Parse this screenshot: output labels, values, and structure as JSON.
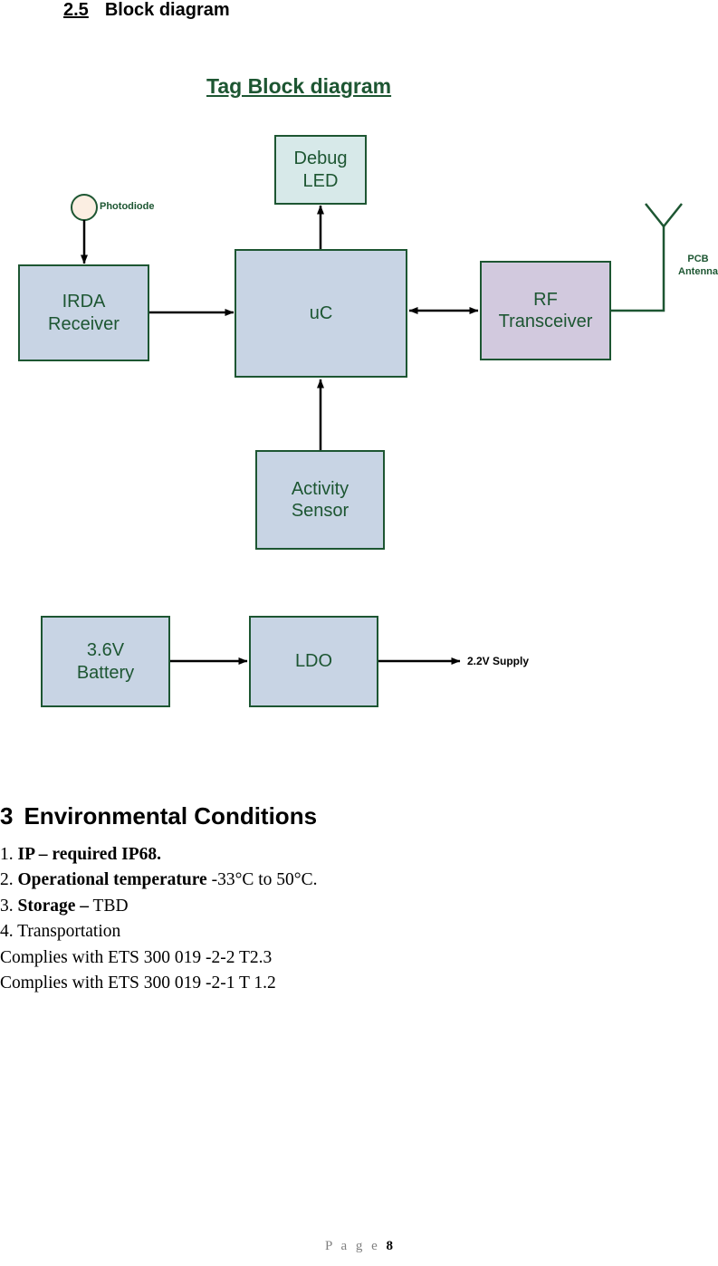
{
  "section": {
    "number": "2.5",
    "title": "Block diagram"
  },
  "diagram": {
    "title": "Tag Block diagram",
    "blocks": [
      {
        "id": "irda",
        "label": "IRDA\nReceiver",
        "fill": "#c8d4e4"
      },
      {
        "id": "uc",
        "label": "uC",
        "fill": "#c8d4e4"
      },
      {
        "id": "led",
        "label": "Debug\nLED",
        "fill": "#d7e9e9"
      },
      {
        "id": "rf",
        "label": "RF\nTransceiver",
        "fill": "#d2c9de"
      },
      {
        "id": "activity",
        "label": "Activity\nSensor",
        "fill": "#c8d4e4"
      },
      {
        "id": "battery",
        "label": "3.6V\nBattery",
        "fill": "#c8d4e4"
      },
      {
        "id": "ldo",
        "label": "LDO",
        "fill": "#c8d4e4"
      }
    ],
    "labels": {
      "photodiode": "Photodiode",
      "pcb_antenna_line1": "PCB",
      "pcb_antenna_line2": "Antenna",
      "supply": "2.2V Supply"
    },
    "colors": {
      "stroke": "#1d5632",
      "arrow": "#000000",
      "photodiode_fill": "#fbeee2",
      "title": "#1d5632"
    }
  },
  "environmental": {
    "heading_number": "3",
    "heading_title": "Environmental Conditions",
    "items": [
      {
        "num": "1.",
        "bold": "IP – required IP68.",
        "rest": ""
      },
      {
        "num": "2.",
        "bold": "Operational temperature",
        "rest": " -33°C to 50°C."
      },
      {
        "num": "3.",
        "bold": "Storage –",
        "rest": " TBD"
      },
      {
        "num": "4.",
        "bold": "",
        "rest": "Transportation"
      }
    ],
    "notes": [
      "Complies with ETS 300 019 -2-2 T2.3",
      "Complies with ETS 300 019 -2-1 T 1.2"
    ]
  },
  "footer": {
    "page_word": "P a g e ",
    "page_number": "8"
  }
}
